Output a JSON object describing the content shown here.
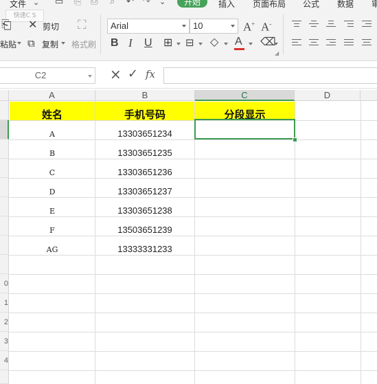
{
  "menu": {
    "file": "文件",
    "tabs": [
      "开始",
      "插入",
      "页面布局",
      "公式",
      "数据",
      "审"
    ]
  },
  "ribbon": {
    "paste_label": "粘贴",
    "cut_label": "剪切",
    "copy_label": "复制",
    "format_painter_label": "格式刷",
    "font_name": "Arial",
    "font_size": "10",
    "watermark": "快速C S"
  },
  "formula_bar": {
    "cell_ref": "C2",
    "cancel_icon": "×",
    "confirm_icon": "✓",
    "fx_label": "fx",
    "value": ""
  },
  "sheet": {
    "columns": [
      "A",
      "B",
      "C",
      "D"
    ],
    "selected_column": "C",
    "selected_cell": "C2",
    "row_numbers_partial": [
      "0",
      "1",
      "2",
      "3",
      "4"
    ],
    "header_fill": "#ffff00",
    "headers": [
      "姓名",
      "手机号码",
      "分段显示"
    ],
    "rows": [
      {
        "name": "A",
        "phone": "13303651234"
      },
      {
        "name": "B",
        "phone": "13303651235"
      },
      {
        "name": "C",
        "phone": "13303651236"
      },
      {
        "name": "D",
        "phone": "13303651237"
      },
      {
        "name": "E",
        "phone": "13303651238"
      },
      {
        "name": "F",
        "phone": "13503651239"
      },
      {
        "name": "AG",
        "phone": "13333331233"
      }
    ]
  },
  "colors": {
    "accent_green": "#46a35a",
    "selection_border": "#3c9a4f",
    "underline_red": "#d9302a"
  }
}
